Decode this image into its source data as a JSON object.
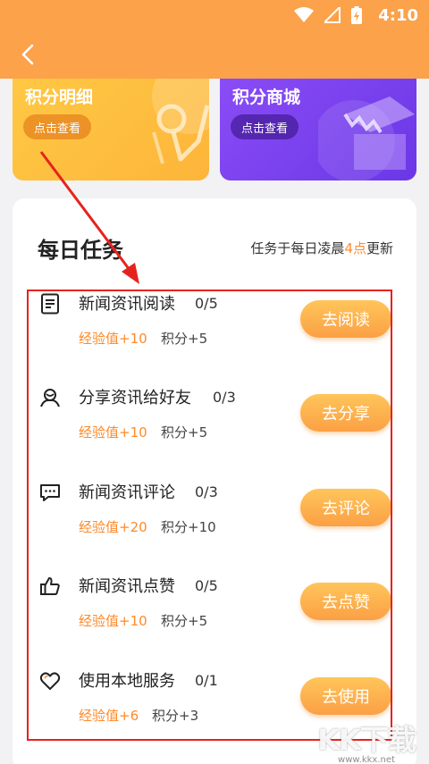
{
  "status": {
    "time": "4:10"
  },
  "cards": [
    {
      "title": "积分明细",
      "button": "点击查看"
    },
    {
      "title": "积分商城",
      "button": "点击查看"
    }
  ],
  "tasks_panel": {
    "title": "每日任务",
    "note_prefix": "任务于每日凌晨",
    "note_highlight": "4点",
    "note_suffix": "更新"
  },
  "tasks": [
    {
      "name": "新闻资讯阅读",
      "progress": "0/5",
      "exp": "经验值+10",
      "points": "积分+5",
      "button": "去阅读",
      "icon": "document-icon"
    },
    {
      "name": "分享资讯给好友",
      "progress": "0/3",
      "exp": "经验值+10",
      "points": "积分+5",
      "button": "去分享",
      "icon": "users-icon"
    },
    {
      "name": "新闻资讯评论",
      "progress": "0/3",
      "exp": "经验值+20",
      "points": "积分+10",
      "button": "去评论",
      "icon": "comment-icon"
    },
    {
      "name": "新闻资讯点赞",
      "progress": "0/5",
      "exp": "经验值+10",
      "points": "积分+5",
      "button": "去点赞",
      "icon": "thumbs-up-icon"
    },
    {
      "name": "使用本地服务",
      "progress": "0/1",
      "exp": "经验值+6",
      "points": "积分+3",
      "button": "去使用",
      "icon": "heart-icon"
    }
  ],
  "watermark": {
    "main": "KK下载",
    "sub": "www.kkx.net"
  },
  "colors": {
    "header": "#fba24a",
    "accent": "#ff8a2a",
    "annotation": "#e5231e"
  }
}
